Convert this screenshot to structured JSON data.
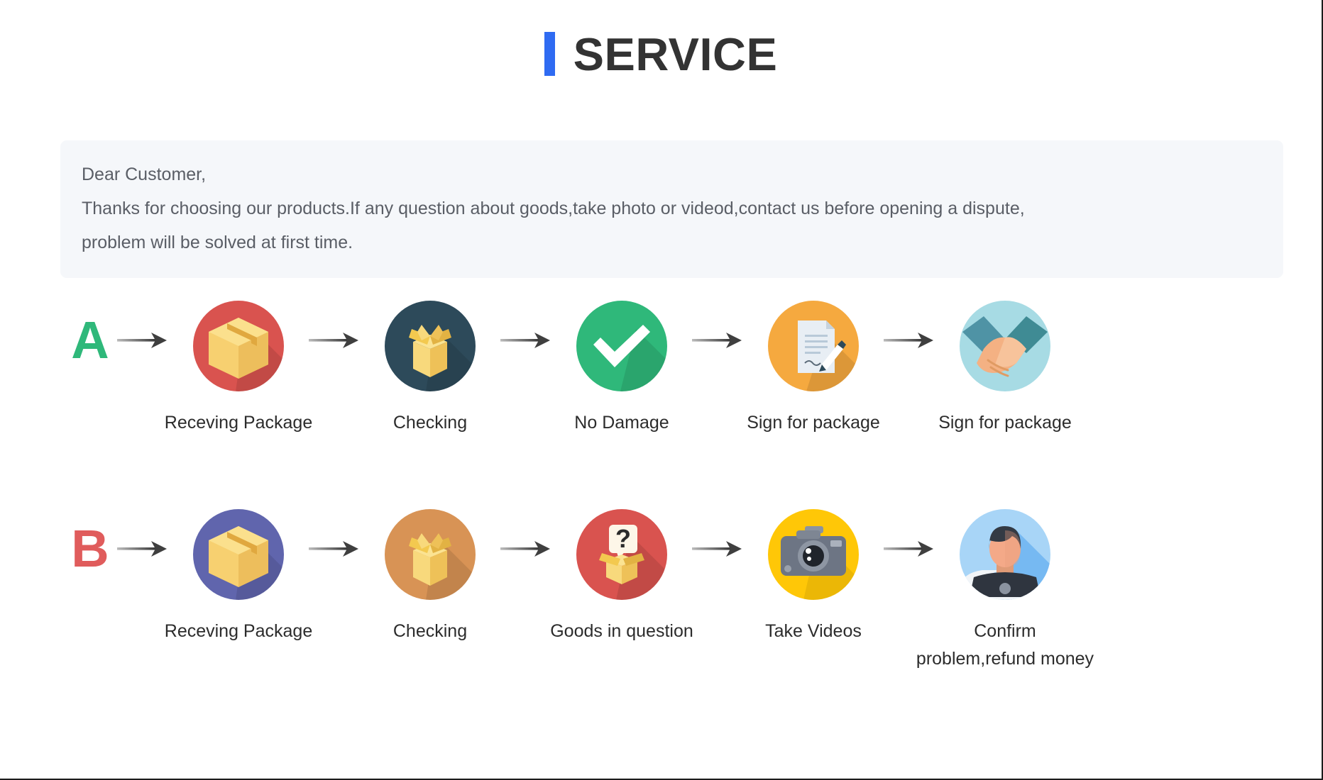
{
  "header": {
    "title": "SERVICE",
    "accent_color": "#2f6bf2",
    "title_color": "#333333"
  },
  "notice": {
    "background": "#f5f7fa",
    "lines": [
      "Dear Customer,",
      "Thanks for choosing our products.If any question about goods,take photo or videod,contact us before opening a dispute,",
      "problem will be solved at first time."
    ]
  },
  "flows": [
    {
      "letter": "A",
      "letter_color": "#2fb87a",
      "steps": [
        {
          "icon": "sealed-package-icon",
          "circle_color": "#d9534f",
          "label": "Receving Package"
        },
        {
          "icon": "open-box-icon",
          "circle_color": "#2d4a5a",
          "label": "Checking"
        },
        {
          "icon": "checkmark-icon",
          "circle_color": "#2fb87a",
          "label": "No Damage"
        },
        {
          "icon": "document-pen-icon",
          "circle_color": "#f5a93f",
          "label": "Sign for package"
        },
        {
          "icon": "handshake-icon",
          "circle_color": "#a7dbe4",
          "label": "Sign for package"
        }
      ]
    },
    {
      "letter": "B",
      "letter_color": "#e05c5c",
      "steps": [
        {
          "icon": "sealed-package-icon",
          "circle_color": "#6065ad",
          "label": "Receving Package"
        },
        {
          "icon": "open-box-icon",
          "circle_color": "#d89355",
          "label": "Checking"
        },
        {
          "icon": "question-box-icon",
          "circle_color": "#d9534f",
          "label": "Goods in question"
        },
        {
          "icon": "camera-icon",
          "circle_color": "#ffc707",
          "label": "Take Videos"
        },
        {
          "icon": "support-person-icon",
          "circle_color": "#a8d5f7",
          "label": "Confirm problem,refund money"
        }
      ]
    }
  ],
  "arrow": {
    "name": "arrow-right-icon",
    "color": "#3f3f3f"
  }
}
